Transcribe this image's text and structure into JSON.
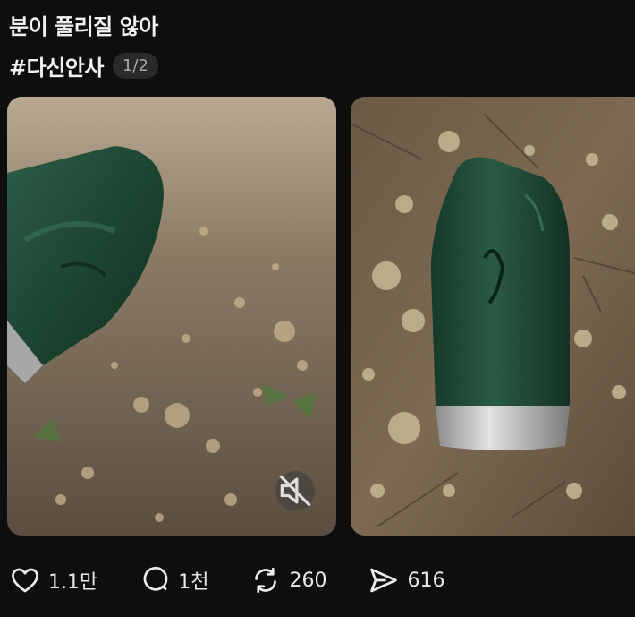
{
  "post": {
    "title": "분이 풀리질 않아",
    "hashtag": "#다신안사",
    "pager": "1/2"
  },
  "media": [
    {
      "type": "video",
      "muted": true,
      "mute_icon": "speaker-muted-icon"
    },
    {
      "type": "image"
    }
  ],
  "actions": {
    "likes": "1.1만",
    "replies": "1천",
    "reposts": "260",
    "shares": "616"
  },
  "colors": {
    "background": "#0e0e0e",
    "text": "#f1f1f1",
    "pager_bg": "#2a2a2a",
    "tumbler_green": "#1f4a37"
  }
}
